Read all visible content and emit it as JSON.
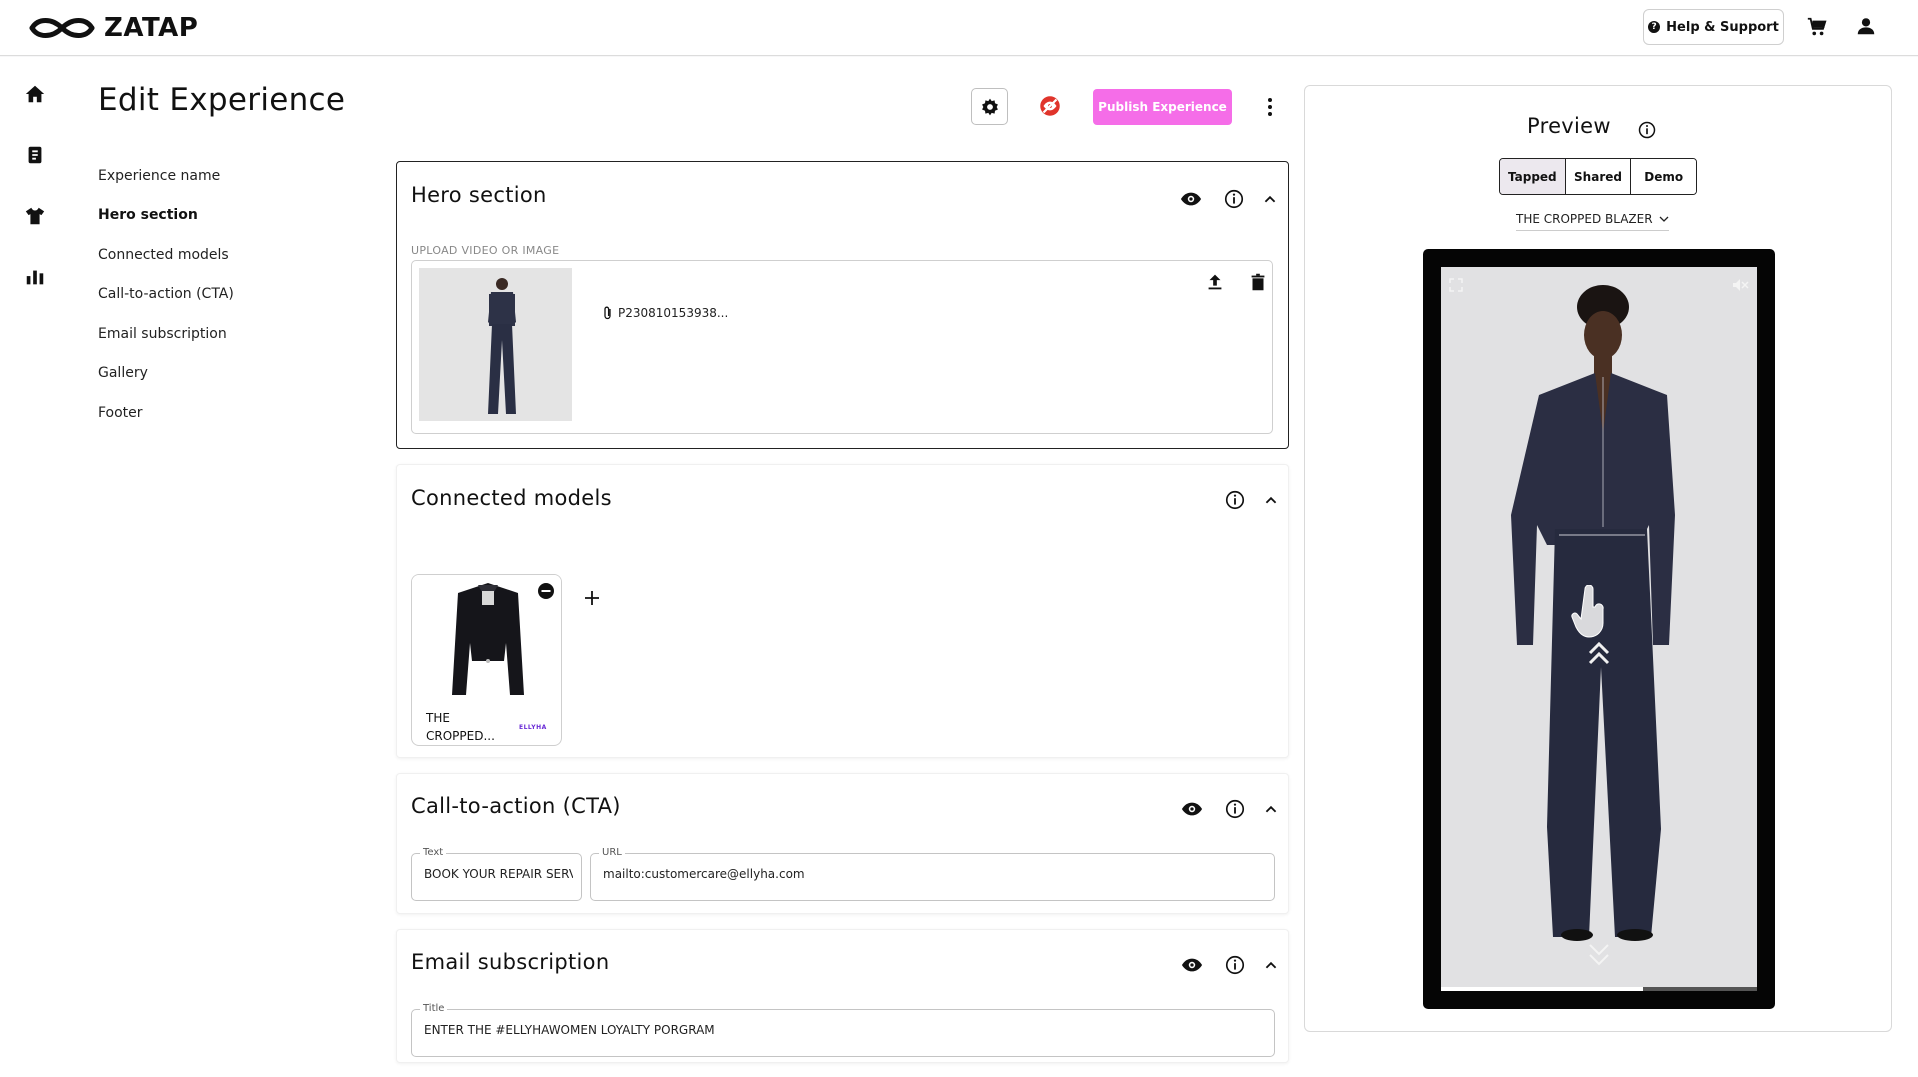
{
  "app": {
    "brand": "ZATAP",
    "help_label": "Help & Support"
  },
  "page": {
    "title": "Edit Experience",
    "publish_label": "Publish Experience"
  },
  "section_nav": [
    {
      "label": "Experience name",
      "active": false
    },
    {
      "label": "Hero section",
      "active": true
    },
    {
      "label": "Connected models",
      "active": false
    },
    {
      "label": "Call-to-action (CTA)",
      "active": false
    },
    {
      "label": "Email subscription",
      "active": false
    },
    {
      "label": "Gallery",
      "active": false
    },
    {
      "label": "Footer",
      "active": false
    }
  ],
  "hero": {
    "title": "Hero section",
    "upload_label": "UPLOAD VIDEO OR IMAGE",
    "file_name": "P230810153938..."
  },
  "connected": {
    "title": "Connected models",
    "model_name": "THE CROPPED...",
    "model_brand": "ELLYHA"
  },
  "cta": {
    "title": "Call-to-action (CTA)",
    "text_label": "Text",
    "text_value": "BOOK YOUR REPAIR SERVICE",
    "url_label": "URL",
    "url_value": "mailto:customercare@ellyha.com"
  },
  "email": {
    "title": "Email subscription",
    "title_label": "Title",
    "title_value": "ENTER THE #ELLYHAWOMEN LOYALTY PORGRAM"
  },
  "preview": {
    "title": "Preview",
    "tabs": [
      {
        "label": "Tapped",
        "active": true
      },
      {
        "label": "Shared",
        "active": false
      },
      {
        "label": "Demo",
        "active": false
      }
    ],
    "product": "THE CROPPED BLAZER",
    "progress": 0.64
  },
  "colors": {
    "accent": "#f56de8",
    "hide_icon": "#e0342b",
    "brand_text": "#6a2bd6"
  }
}
